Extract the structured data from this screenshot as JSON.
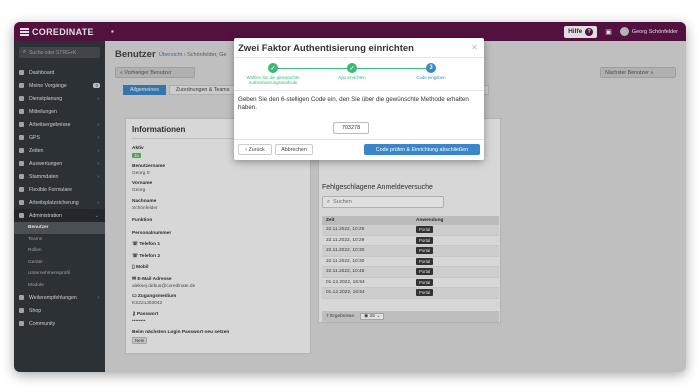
{
  "app": {
    "brand": "COREDINATE",
    "help_label": "Hilfe",
    "user_name": "Georg Schönfelder"
  },
  "sidebar": {
    "search_placeholder": "Suche oder STRG+K",
    "items": [
      {
        "label": "Dashboard"
      },
      {
        "label": "Meine Vorgänge",
        "badge": "0"
      },
      {
        "label": "Dienstplanung"
      },
      {
        "label": "Mitteilungen"
      },
      {
        "label": "Arbeitsergebnisse"
      },
      {
        "label": "GPS"
      },
      {
        "label": "Zeiten"
      },
      {
        "label": "Auswertungen"
      },
      {
        "label": "Stammdaten"
      },
      {
        "label": "Flexible Formulare"
      },
      {
        "label": "Arbeitsplatzsicherung"
      },
      {
        "label": "Administration"
      }
    ],
    "sub_items": [
      {
        "label": "Benutzer"
      },
      {
        "label": "Teams"
      },
      {
        "label": "Rollen"
      },
      {
        "label": "Geräte"
      },
      {
        "label": "Unternehmensprofil"
      },
      {
        "label": "Module"
      }
    ],
    "bottom_items": [
      {
        "label": "Weiterempfehlungen"
      },
      {
        "label": "Shop"
      },
      {
        "label": "Community"
      }
    ]
  },
  "page": {
    "title": "Benutzer",
    "breadcrumb_link": "Übersicht",
    "breadcrumb_rest": "› Schönfelder, Ge",
    "prev_button": "« Vorheriger Benutzer",
    "next_button": "Nächster Benutzer »",
    "tabs": [
      "Allgemeines",
      "Zuordnungen & Teams"
    ],
    "tab_right": "le"
  },
  "info": {
    "title": "Informationen",
    "aktiv_label": "Aktiv",
    "aktiv_value": "Ja",
    "benutzername_label": "Benutzername",
    "benutzername_value": "Georg S",
    "vorname_label": "Vorname",
    "vorname_value": "Georg",
    "nachname_label": "Nachname",
    "nachname_value": "Schönfelder",
    "funktion_label": "Funktion",
    "personalnummer_label": "Personalnummer",
    "telefon1_label": "Telefon 1",
    "telefon2_label": "Telefon 2",
    "mobil_label": "Mobil",
    "email_label": "E-Mail Adresse",
    "email_value": "aleksej.debus@coredinate.de",
    "zugang_label": "Zugangsmedium",
    "zugang_value": "KS221J03042",
    "passwort_label": "Passwort",
    "passwort_value": "••••••••",
    "reset_label": "Beim nächsten Login Passwort neu setzen",
    "reset_value": "Nein"
  },
  "failed_logins": {
    "title": "Fehlgeschlagene Anmeldeversuche",
    "search_placeholder": "Suchen",
    "columns": [
      "Zeit",
      "Anwendung"
    ],
    "rows": [
      {
        "time": "22.11.2022, 10:29",
        "app": "Portal"
      },
      {
        "time": "22.11.2022, 10:29",
        "app": "Portal"
      },
      {
        "time": "22.11.2022, 10:30",
        "app": "Portal"
      },
      {
        "time": "22.11.2022, 10:30",
        "app": "Portal"
      },
      {
        "time": "22.11.2022, 10:48",
        "app": "Portal"
      },
      {
        "time": "01.12.2022, 16:54",
        "app": "Portal"
      },
      {
        "time": "01.12.2022, 16:54",
        "app": "Portal"
      }
    ],
    "footer_count": "7 Ergebnisse",
    "page_size": "25"
  },
  "modal": {
    "title": "Zwei Faktor Authentisierung einrichten",
    "steps": [
      {
        "label": "Wählen Sie die gewünschte Authentisierungsmethode",
        "state": "done"
      },
      {
        "label": "App einrichten",
        "state": "done"
      },
      {
        "label": "Code eingeben",
        "state": "current",
        "number": "3"
      }
    ],
    "instruction": "Geben Sie den 6-stelligen Code ein, den Sie über die gewünschte Methode erhalten haben.",
    "code_value": "703278",
    "back_button": "‹ Zurück",
    "cancel_button": "Abbrechen",
    "submit_button": "Code prüfen & Einrichtung abschließen"
  },
  "colors": {
    "brand": "#5f1448",
    "primary": "#3a86c8",
    "success": "#3cb878",
    "sidebar": "#33383e"
  }
}
